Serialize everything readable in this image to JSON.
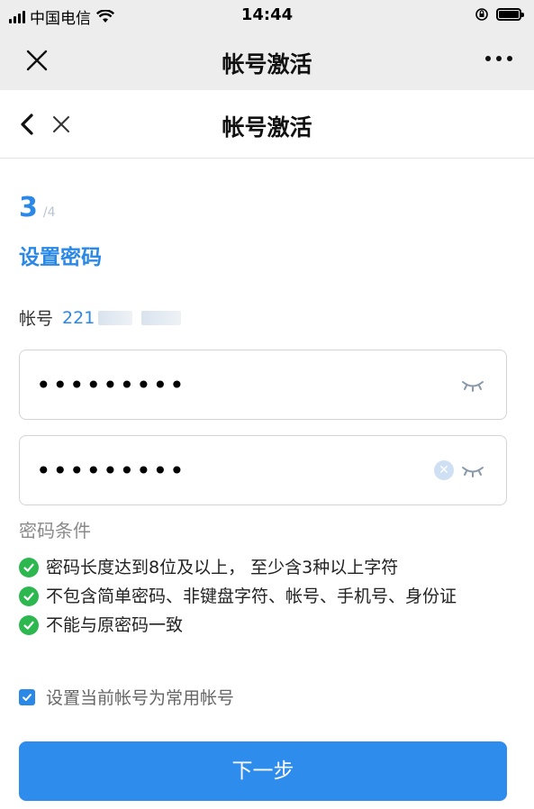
{
  "status_bar": {
    "carrier": "中国电信",
    "time": "14:44"
  },
  "wechat_bar": {
    "title": "帐号激活"
  },
  "page_header": {
    "title": "帐号激活"
  },
  "step": {
    "current": "3",
    "total": "/4",
    "title": "设置密码"
  },
  "account": {
    "label": "帐号",
    "value_prefix": "221"
  },
  "password_field": {
    "value": "•••••••••"
  },
  "confirm_field": {
    "value": "•••••••••"
  },
  "conditions": {
    "title": "密码条件",
    "items": [
      "密码长度达到8位及以上， 至少含3种以上字符",
      "不包含简单密码、非键盘字符、帐号、手机号、身份证",
      "不能与原密码一致"
    ]
  },
  "set_common": {
    "label": "设置当前帐号为常用帐号",
    "checked": true
  },
  "next_button": {
    "label": "下一步"
  },
  "colors": {
    "accent": "#2a88e6",
    "button": "#2e8cec",
    "success": "#2cb84f"
  }
}
